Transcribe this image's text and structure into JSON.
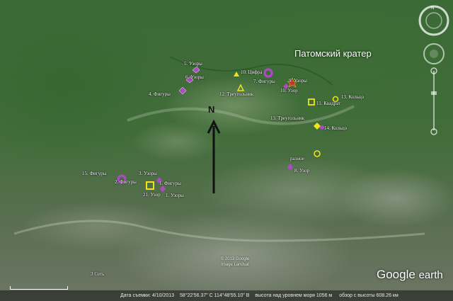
{
  "map": {
    "crater_label": "Патомский кратер",
    "north_label": "N",
    "copyright": "© 2013 Google\nImage Landsat",
    "logo_a": "Google",
    "logo_b": "earth",
    "bottom_left_label": "3 Сеть"
  },
  "labels": [
    {
      "text": "5. Узоры"
    },
    {
      "text": "6. Узоры"
    },
    {
      "text": "4. Фигуры"
    },
    {
      "text": "10. Цифра"
    },
    {
      "text": "7. Фигуры"
    },
    {
      "text": "9. Узоры"
    },
    {
      "text": "10. Узор"
    },
    {
      "text": "12. Треугольник"
    },
    {
      "text": "11. Квадрат"
    },
    {
      "text": "13. Кольцо"
    },
    {
      "text": "13. Треугольник"
    },
    {
      "text": "14. Кольцо"
    },
    {
      "text": "разное"
    },
    {
      "text": "8. Узор"
    },
    {
      "text": "15. Фигуры"
    },
    {
      "text": "3. Узоры"
    },
    {
      "text": "2. Фигуры"
    },
    {
      "text": "1. Фигуры"
    },
    {
      "text": "21. Узор"
    },
    {
      "text": "1. Узоры"
    }
  ],
  "status": {
    "date": "Дата съемки: 4/10/2013",
    "coords": "58°22'56.37\" С  114°48'55.10\" В",
    "elev": "высота над уровнем моря  1056 м",
    "eye": "обзор с высоты  608.26 км"
  },
  "colors": {
    "marker_purple": "#b048c8",
    "marker_yellow": "#f2e21a",
    "marker_red": "#d03030"
  },
  "icons": [
    "look-around-icon",
    "move-icon",
    "zoom-slider-icon"
  ]
}
